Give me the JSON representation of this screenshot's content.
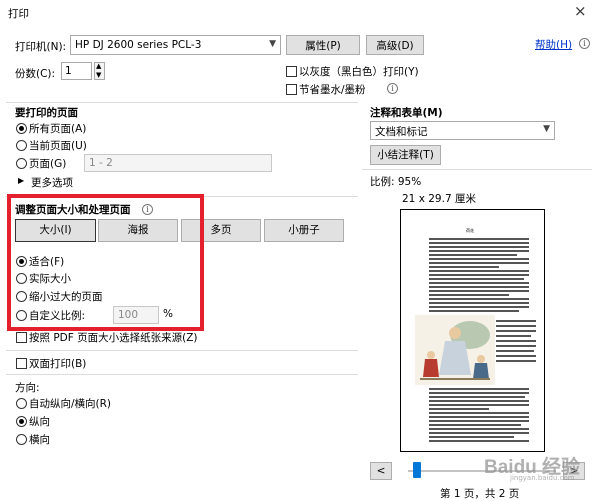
{
  "window": {
    "title": "打印",
    "close_glyph": "×"
  },
  "printer": {
    "label": "打印机(N):",
    "selected": "HP DJ 2600 series PCL-3",
    "properties_button": "属性(P)",
    "advanced_button": "高级(D)",
    "help_link": "帮助(H)"
  },
  "copies": {
    "label": "份数(C):",
    "value": "1",
    "grayscale_label": "以灰度（黑白色）打印(Y)",
    "save_ink_label": "节省墨水/墨粉"
  },
  "pages_to_print": {
    "title": "要打印的页面",
    "all_label": "所有页面(A)",
    "current_label": "当前页面(U)",
    "pages_label": "页面(G)",
    "pages_placeholder": "1 - 2",
    "more_options": "更多选项"
  },
  "page_sizing": {
    "title": "调整页面大小和处理页面",
    "tabs": [
      "大小(I)",
      "海报",
      "多页",
      "小册子"
    ],
    "fit_label": "适合(F)",
    "actual_label": "实际大小",
    "shrink_label": "缩小过大的页面",
    "custom_label": "自定义比例:",
    "custom_value": "100",
    "percent": "%",
    "pdf_source_label": "按照 PDF 页面大小选择纸张来源(Z)"
  },
  "duplex": {
    "label": "双面打印(B)"
  },
  "orientation": {
    "title": "方向:",
    "auto_label": "自动纵向/横向(R)",
    "portrait_label": "纵向",
    "landscape_label": "横向"
  },
  "comments": {
    "title": "注释和表单(M)",
    "selected": "文档和标记",
    "summarize_button": "小结注释(T)"
  },
  "preview": {
    "scale": "比例:  95%",
    "paper_size": "21 x 29.7 厘米",
    "doc_title": "荷花",
    "page_status": "第 1 页，共 2 页",
    "prev_glyph": "<",
    "next_glyph": ">"
  },
  "watermark": {
    "text": "Baidu 经验",
    "sub": "jingyan.baidu.com"
  },
  "colors": {
    "highlight": "#e3202b",
    "link": "#0033cc",
    "slider": "#0078d7"
  }
}
